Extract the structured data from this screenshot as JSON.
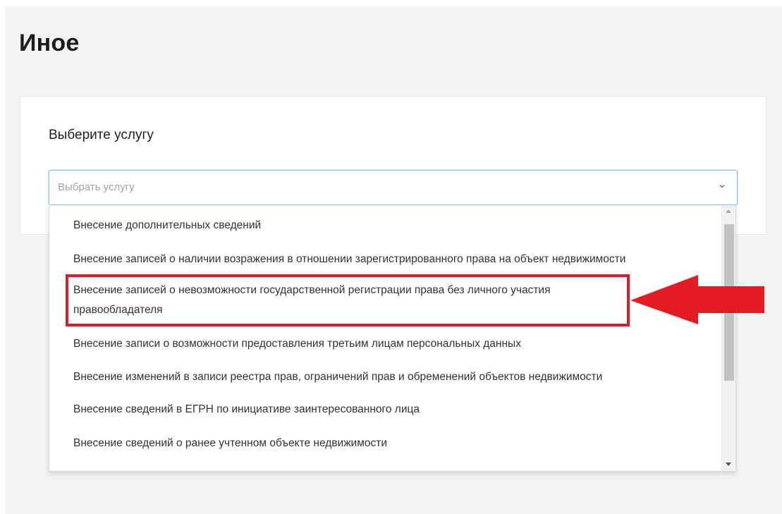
{
  "page": {
    "title": "Иное"
  },
  "form": {
    "label": "Выберите услугу",
    "select_placeholder": "Выбрать услугу"
  },
  "dropdown": {
    "options": [
      {
        "label": "Внесение дополнительных сведений"
      },
      {
        "label": "Внесение записей о наличии возражения в отношении зарегистрированного права на объект недвижимости"
      },
      {
        "label": "Внесение записей о невозможности государственной регистрации права без личного участия правообладателя",
        "highlighted": true
      },
      {
        "label": "Внесение записи о возможности предоставления третьим лицам персональных данных"
      },
      {
        "label": "Внесение изменений в записи реестра прав, ограничений прав и обременений объектов недвижимости"
      },
      {
        "label": "Внесение сведений в ЕГРН по инициативе заинтересованного лица"
      },
      {
        "label": "Внесение сведений о ранее учтенном объекте недвижимости"
      }
    ]
  },
  "annotation": {
    "color": "#d5202a",
    "icon": "red-arrow-left-icon"
  },
  "colors": {
    "select_border": "#8cc4ec",
    "background": "#f3f3f3"
  }
}
